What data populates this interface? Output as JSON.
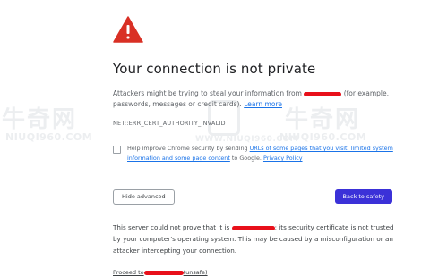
{
  "watermark": {
    "cn": "牛奇网",
    "en": "NIUQI960.COM",
    "en_small": "WWW.NIUQI960.COM"
  },
  "page": {
    "warning_icon": "warning-triangle-icon",
    "warning_color": "#d93025",
    "title": "Your connection is not private",
    "intro_before": "Attackers might be trying to steal your information from",
    "intro_after": "(for example, passwords, messages or credit cards).",
    "learn_more": "Learn more",
    "error_code": "NET::ERR_CERT_AUTHORITY_INVALID",
    "checkbox_before": "Help improve Chrome security by sending",
    "checkbox_link": "URLs of some pages that you visit, limited system information and some page content",
    "checkbox_mid": "to Google.",
    "privacy_policy": "Privacy Policy",
    "hide_advanced": "Hide advanced",
    "back_to_safety": "Back to safety",
    "primary_color": "#3b31d8",
    "details_before": "This server could not prove that it is",
    "details_after": "; its security certificate is not trusted by your computer's operating system. This may be caused by a misconfiguration or an attacker intercepting your connection.",
    "proceed_before": "Proceed to",
    "proceed_after": "(unsafe)",
    "redaction_color": "#e8101a"
  }
}
